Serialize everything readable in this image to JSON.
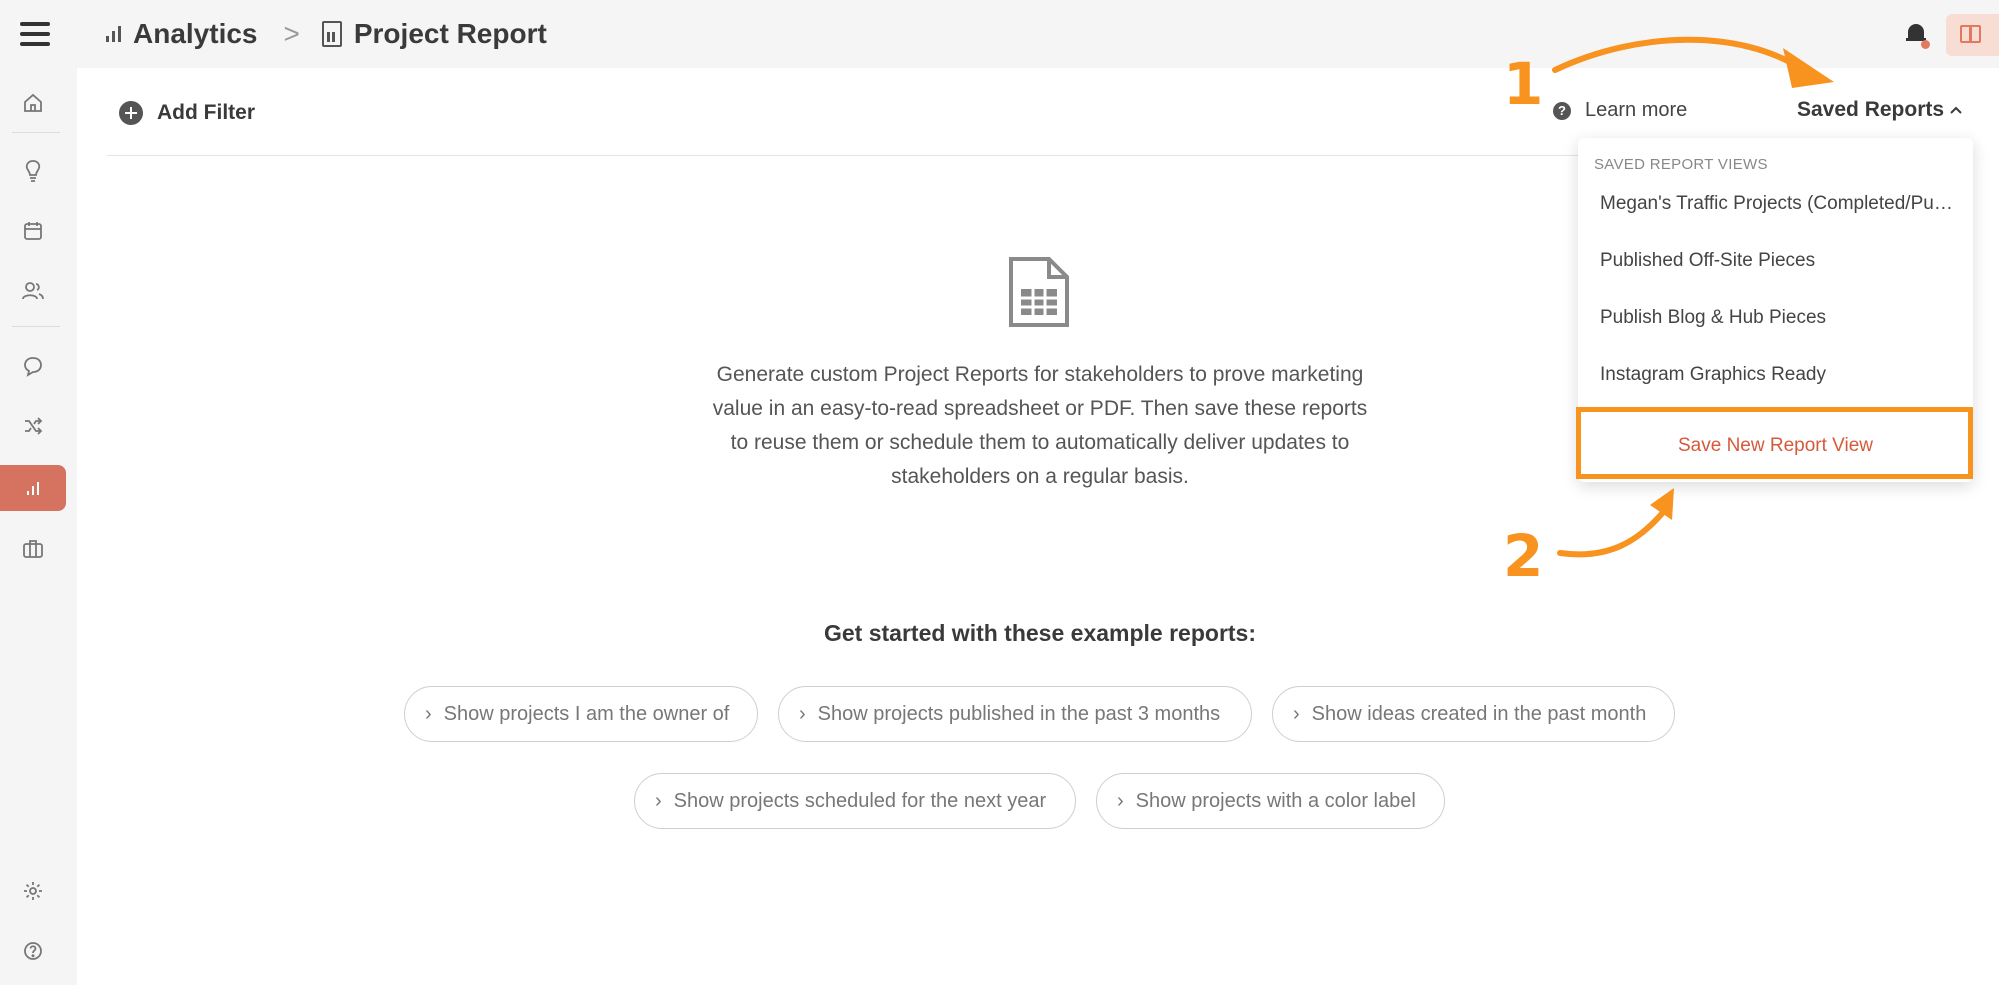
{
  "header": {
    "section": "Analytics",
    "separator": ">",
    "page": "Project Report"
  },
  "sidebar": {
    "items": [
      {
        "icon": "home-icon"
      },
      {
        "icon": "lightbulb-icon"
      },
      {
        "icon": "calendar-icon"
      },
      {
        "icon": "people-icon"
      },
      {
        "icon": "chat-icon"
      },
      {
        "icon": "shuffle-icon"
      },
      {
        "icon": "analytics-icon",
        "active": true
      },
      {
        "icon": "briefcase-icon"
      },
      {
        "icon": "gear-icon"
      },
      {
        "icon": "help-icon"
      }
    ]
  },
  "toolbar": {
    "add_filter": "Add Filter",
    "learn_more": "Learn more",
    "saved_reports": "Saved Reports",
    "learn_more_icon": "?",
    "saved_reports_caret": "^"
  },
  "empty_state": {
    "description_lines": [
      "Generate custom Project Reports for stakeholders to prove marketing",
      "value in an easy-to-read spreadsheet or PDF. Then save these reports",
      "to reuse them or schedule them to automatically deliver updates to",
      "stakeholders on a regular basis."
    ],
    "get_started": "Get started with these example reports:",
    "examples": [
      "Show projects I am the owner of",
      "Show projects published in the past 3 months",
      "Show ideas created in the past month",
      "Show projects scheduled for the next year",
      "Show projects with a color label"
    ]
  },
  "dropdown": {
    "header": "SAVED REPORT VIEWS",
    "items": [
      "Megan's Traffic Projects (Completed/Published)",
      "Published Off-Site Pieces",
      "Publish Blog & Hub Pieces",
      "Instagram Graphics Ready"
    ],
    "save_new": "Save New Report View"
  },
  "annotations": {
    "step1": "1",
    "step2": "2",
    "color": "#f7931e"
  },
  "colors": {
    "accent": "#d57360",
    "link_orange": "#d55a3a"
  }
}
